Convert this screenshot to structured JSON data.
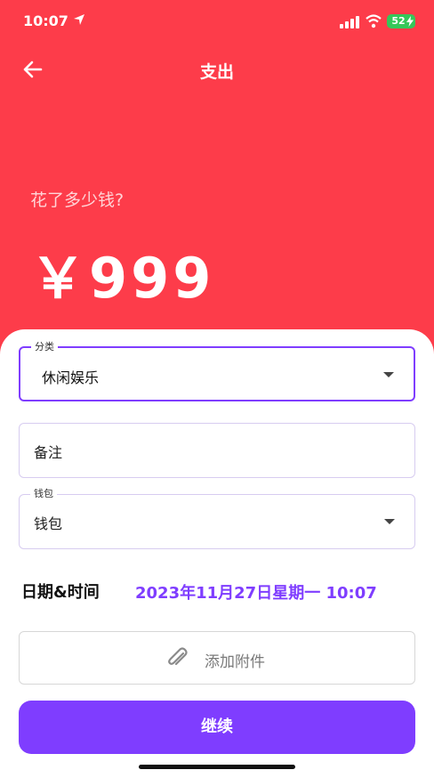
{
  "status_bar": {
    "time": "10:07",
    "battery": "52"
  },
  "header": {
    "title": "支出"
  },
  "amount_section": {
    "question": "花了多少钱?",
    "amount": "￥999"
  },
  "form": {
    "category": {
      "label": "分类",
      "value": "休闲娱乐"
    },
    "note": {
      "placeholder": "备注"
    },
    "wallet": {
      "label": "钱包",
      "value": "钱包"
    },
    "datetime": {
      "label": "日期&时间",
      "value": "2023年11月27日星期一 10:07"
    },
    "attachment": {
      "label": "添加附件"
    },
    "continue_label": "继续"
  },
  "colors": {
    "header_bg": "#fd3c4a",
    "accent": "#7f3dff"
  }
}
